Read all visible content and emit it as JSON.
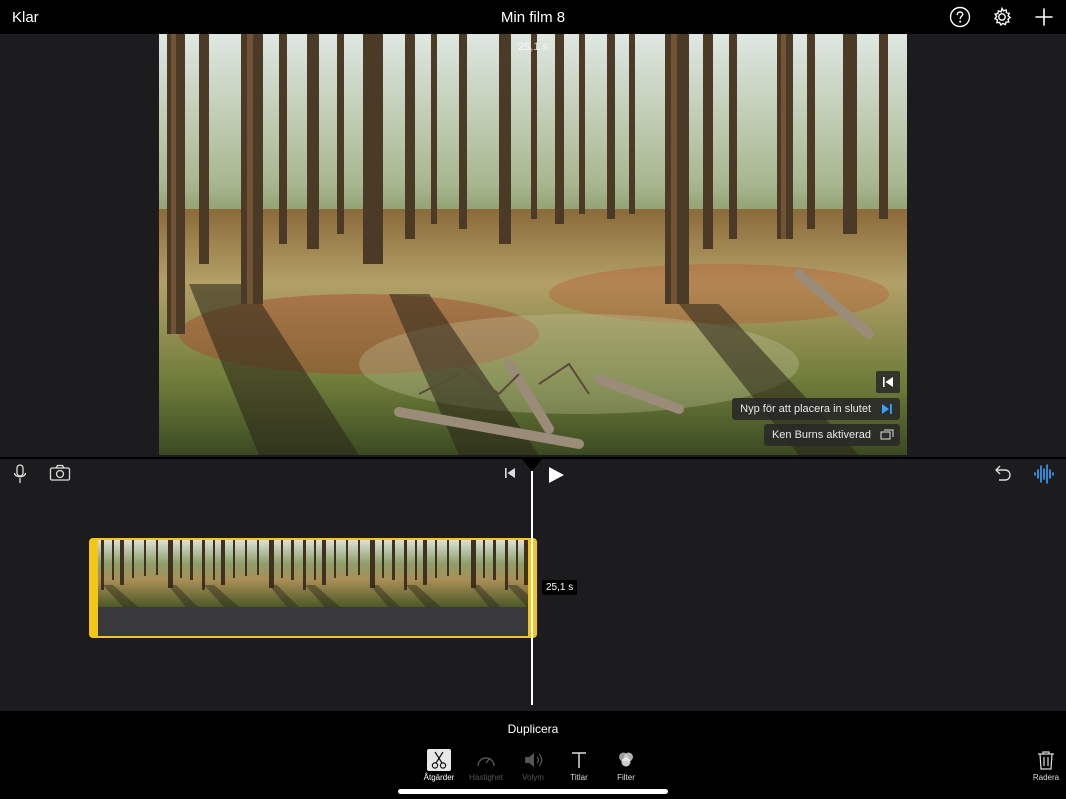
{
  "header": {
    "done_label": "Klar",
    "title": "Min film 8",
    "icons": [
      "help-icon",
      "settings-icon",
      "add-icon"
    ]
  },
  "viewer": {
    "time_overlay": "25,1 s",
    "pinch_hint": "Nyp för att placera in slutet",
    "ken_burns": "Ken Burns aktiverad"
  },
  "timeline": {
    "clip_duration": "25,1 s"
  },
  "toolbar": {
    "selected_action": "Duplicera",
    "tools": [
      {
        "label": "Åtgärder",
        "icon": "scissors-icon",
        "state": "active"
      },
      {
        "label": "Hastighet",
        "icon": "speed-icon",
        "state": "disabled"
      },
      {
        "label": "Volym",
        "icon": "volume-icon",
        "state": "disabled"
      },
      {
        "label": "Titlar",
        "icon": "titles-icon",
        "state": "enabled"
      },
      {
        "label": "Filter",
        "icon": "filter-icon",
        "state": "enabled"
      }
    ],
    "delete_label": "Radera"
  },
  "colors": {
    "accent_yellow": "#f5c518",
    "waveform_blue": "#3aa0ff",
    "background": "#1c1c1e"
  }
}
